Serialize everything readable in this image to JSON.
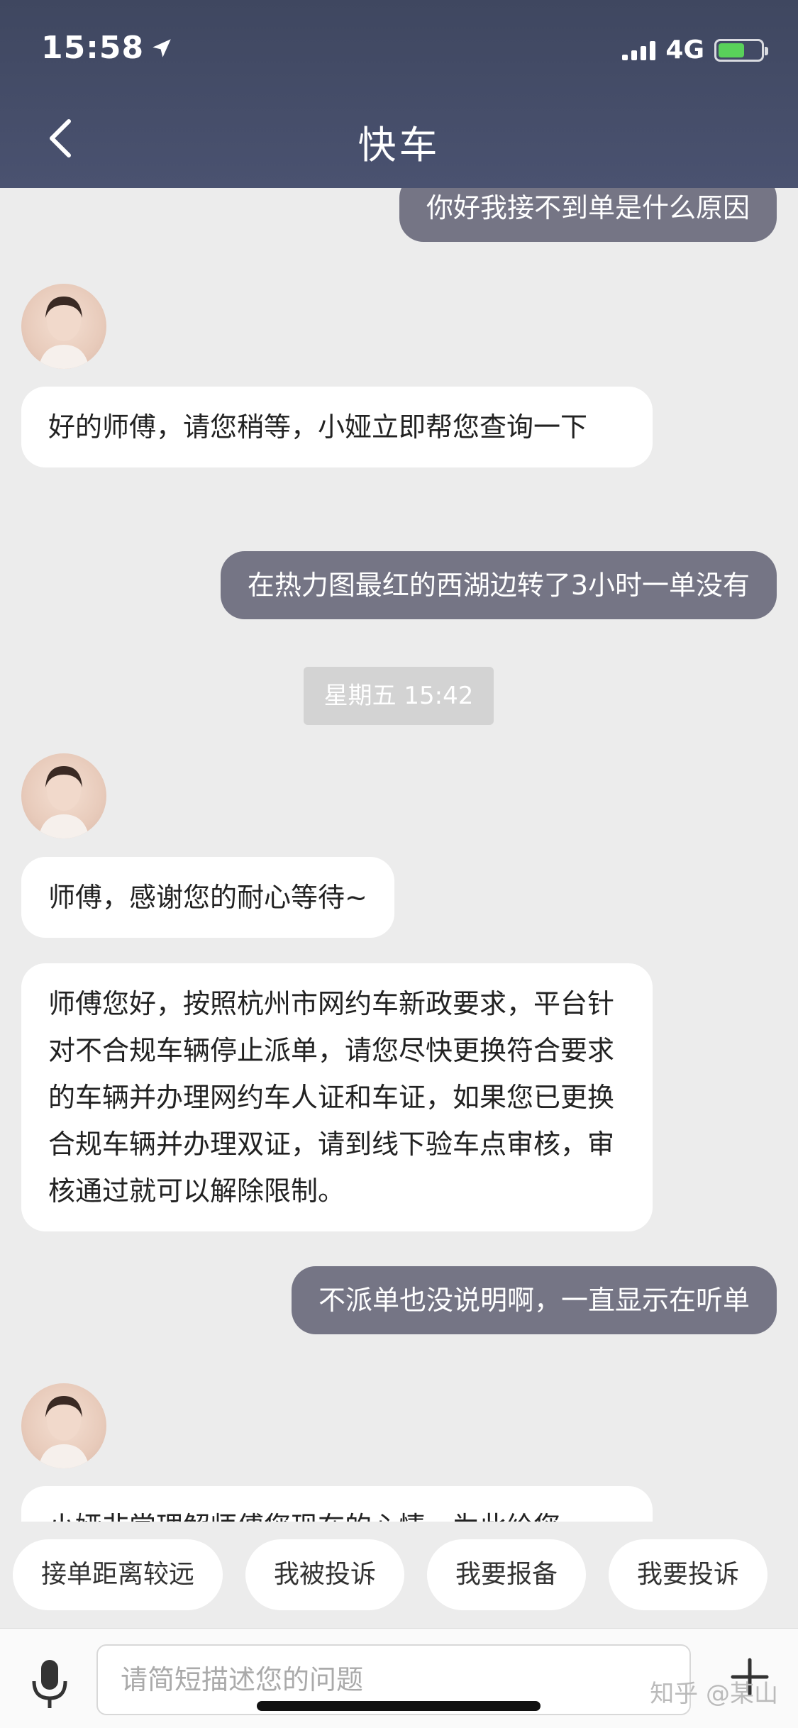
{
  "status_bar": {
    "time": "15:58",
    "network": "4G",
    "battery_level": 0.62,
    "battery_color": "#59d15a"
  },
  "header": {
    "title": "快车",
    "back_icon": "chevron-left-icon",
    "background": "#434b66"
  },
  "messages": {
    "m1": "你好我接不到单是什么原因",
    "m2": "好的师傅，请您稍等，小娅立即帮您查询一下",
    "m3": "在热力图最红的西湖边转了3小时一单没有",
    "timestamp": "星期五 15:42",
    "m4": "师傅，感谢您的耐心等待~",
    "m5": "师傅您好，按照杭州市网约车新政要求，平台针对不合规车辆停止派单，请您尽快更换符合要求的车辆并办理网约车人证和车证，如果您已更换合规车辆并办理双证，请到线下验车点审核，审核通过就可以解除限制。",
    "m6": "不派单也没说明啊，一直显示在听单",
    "m7_partial": "小娅非常理解师傅您现在的心情，为此给您"
  },
  "quick_replies": [
    "接单距离较远",
    "我被投诉",
    "我要报备",
    "我要投诉"
  ],
  "input": {
    "placeholder": "请简短描述您的问题"
  },
  "watermark": "知乎 @某山"
}
